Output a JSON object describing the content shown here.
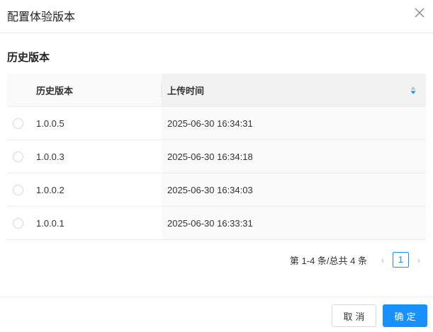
{
  "dialog": {
    "title": "配置体验版本",
    "close_icon": "close-icon"
  },
  "section_title": "历史版本",
  "table": {
    "columns": [
      "历史版本",
      "上传时间"
    ],
    "rows": [
      {
        "version": "1.0.0.5",
        "time": "2025-06-30 16:34:31"
      },
      {
        "version": "1.0.0.3",
        "time": "2025-06-30 16:34:18"
      },
      {
        "version": "1.0.0.2",
        "time": "2025-06-30 16:34:03"
      },
      {
        "version": "1.0.0.1",
        "time": "2025-06-30 16:33:31"
      }
    ]
  },
  "pagination": {
    "total_text": "第 1-4 条/总共 4 条",
    "current": "1",
    "prev": "‹",
    "next": "›"
  },
  "footer": {
    "cancel": "取消",
    "ok": "确定"
  },
  "colors": {
    "primary": "#1890ff"
  }
}
